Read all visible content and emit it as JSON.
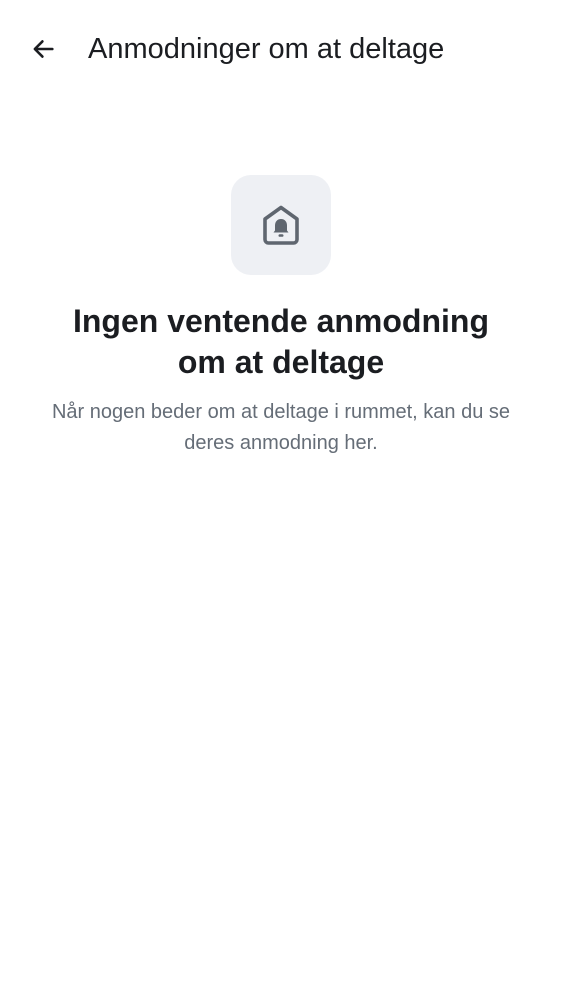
{
  "header": {
    "title": "Anmodninger om at deltage",
    "back_icon": "arrow-left-icon"
  },
  "empty_state": {
    "icon": "home-bell-icon",
    "heading": "Ingen ventende anmodning om at deltage",
    "body": "Når nogen beder om at deltage i rummet, kan du se deres anmodning her."
  },
  "colors": {
    "primary_text": "#1b1d21",
    "secondary_text": "#656d77",
    "icon_tile_bg": "#eef0f4",
    "icon_fill": "#5f666f",
    "background": "#ffffff"
  }
}
